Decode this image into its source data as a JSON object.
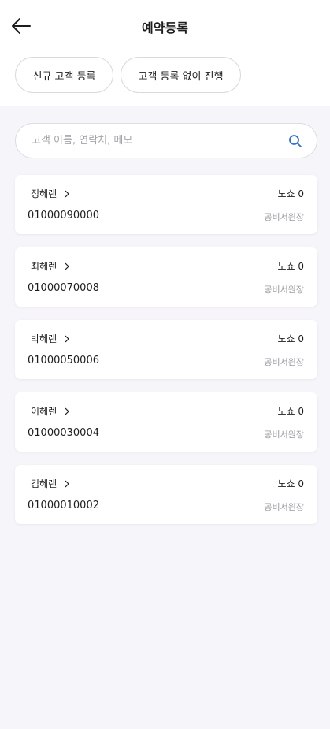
{
  "header": {
    "title": "예약등록",
    "back_icon": "arrow-left-icon"
  },
  "actions": {
    "new_customer": "신규 고객 등록",
    "proceed_without": "고객 등록 없이 진행"
  },
  "search": {
    "placeholder": "고객 이름, 연락처, 메모",
    "icon": "search-icon"
  },
  "colors": {
    "background": "#f6f5fa",
    "card": "#ffffff",
    "accent_search_icon": "#2f6fd6",
    "muted_text": "#9a9aa2"
  },
  "customers": [
    {
      "name": "정헤렌",
      "noshow": "노쇼 0",
      "phone": "01000090000",
      "staff": "공비서원장"
    },
    {
      "name": "최헤렌",
      "noshow": "노쇼 0",
      "phone": "01000070008",
      "staff": "공비서원장"
    },
    {
      "name": "박헤렌",
      "noshow": "노쇼 0",
      "phone": "01000050006",
      "staff": "공비서원장"
    },
    {
      "name": "이헤렌",
      "noshow": "노쇼 0",
      "phone": "01000030004",
      "staff": "공비서원장"
    },
    {
      "name": "김헤렌",
      "noshow": "노쇼 0",
      "phone": "01000010002",
      "staff": "공비서원장"
    }
  ]
}
